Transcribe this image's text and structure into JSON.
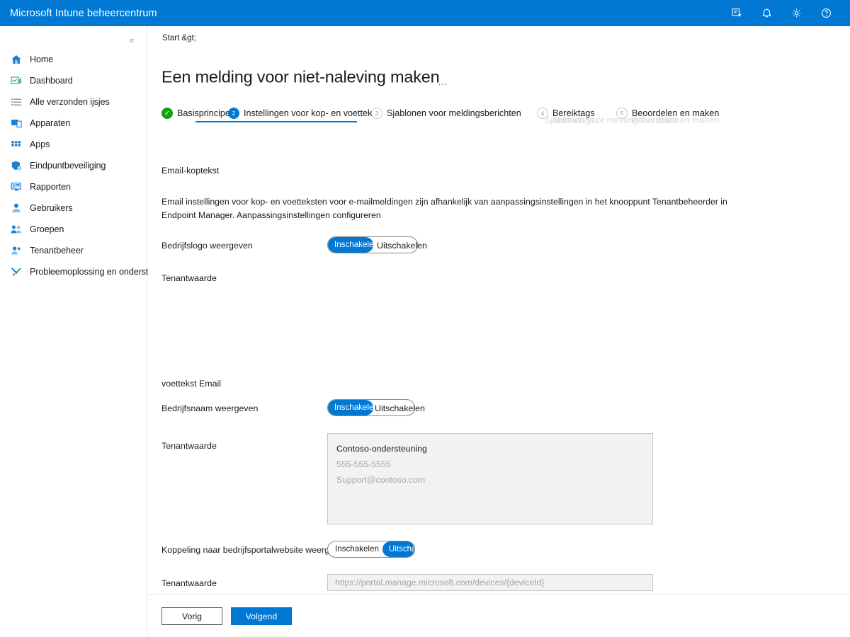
{
  "topbar": {
    "title": "Microsoft Intune beheercentrum",
    "icons": [
      {
        "name": "feedback-icon",
        "label": "Feedback"
      },
      {
        "name": "notifications-bell-icon",
        "label": "Meldingen"
      },
      {
        "name": "settings-gear-icon",
        "label": "Instellingen"
      },
      {
        "name": "help-question-icon",
        "label": "Help"
      }
    ],
    "accent_color": "#0078d4"
  },
  "sidebar": {
    "collapse_glyph": "«",
    "items": [
      {
        "label": "Home",
        "icon": "home-icon"
      },
      {
        "label": "Dashboard",
        "icon": "dashboard-icon"
      },
      {
        "label": "Alle verzonden ijsjes",
        "icon": "list-icon"
      },
      {
        "label": "Apparaten",
        "icon": "devices-icon"
      },
      {
        "label": "Apps",
        "icon": "apps-grid-icon"
      },
      {
        "label": "Eindpuntbeveiliging",
        "icon": "shield-icon"
      },
      {
        "label": "Rapporten",
        "icon": "reports-monitor-icon"
      },
      {
        "label": "Gebruikers",
        "icon": "user-icon"
      },
      {
        "label": "Groepen",
        "icon": "users-group-icon"
      },
      {
        "label": "Tenantbeheer",
        "icon": "tenant-admin-icon"
      },
      {
        "label": "Probleemoplossing en ondersteuning",
        "icon": "tools-wrench-icon"
      }
    ]
  },
  "page": {
    "breadcrumb": "Start &gt;",
    "title": "Een melding voor niet-naleving maken",
    "more_actions": "…"
  },
  "wizard": {
    "steps": [
      {
        "number": "✓",
        "label": "Basisprincipes",
        "state": "done"
      },
      {
        "number": "2",
        "label": "Instellingen voor kop- en voettekst",
        "state": "active"
      },
      {
        "number": "3",
        "label": "Sjablonen voor meldingsberichten",
        "state": "idle"
      },
      {
        "number": "4",
        "label": "Bereiktags",
        "state": "idle"
      },
      {
        "number": "5",
        "label": "Beoordelen en maken",
        "state": "idle"
      }
    ]
  },
  "form": {
    "header_section_title": "Email-koptekst",
    "help_text": "Email instellingen voor kop- en voetteksten voor e-mailmeldingen zijn afhankelijk van aanpassingsinstellingen in het knooppunt Tenantbeheerder in Endpoint Manager. Aanpassingsinstellingen configureren",
    "show_logo": {
      "label": "Bedrijfslogo weergeven",
      "option_on": "Inschakelen",
      "option_off": "Uitschakelen",
      "selected": "Inschakelen"
    },
    "header_tenant_value_label": "Tenantwaarde",
    "footer_section_title": "voettekst Email",
    "show_company_name": {
      "label": "Bedrijfsnaam weergeven",
      "option_on": "Inschakelen",
      "option_off": "Uitschakelen",
      "selected": "Inschakelen"
    },
    "footer_tenant_value_label": "Tenantwaarde",
    "footer_tenant_value_lines": [
      {
        "text": "Contoso-ondersteuning",
        "style": "filled"
      },
      {
        "text": "555-555-5555",
        "style": "placeholder"
      },
      {
        "text": "Support@contoso.com",
        "style": "placeholder"
      }
    ],
    "show_portal_link": {
      "label": "Koppeling naar bedrijfsportalwebsite weergeven",
      "option_on": "Inschakelen",
      "option_off": "Uitschakelen",
      "selected": "Uitschakelen"
    },
    "portal_tenant_value_label": "Tenantwaarde",
    "portal_url_placeholder": "https://portal.manage.microsoft.com/devices/{deviceId}"
  },
  "footer": {
    "previous": "Vorig",
    "next": "Volgend"
  }
}
